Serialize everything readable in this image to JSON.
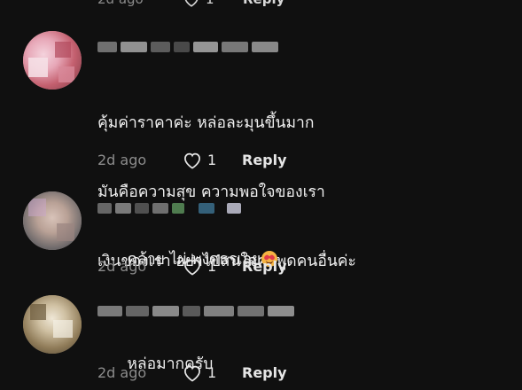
{
  "top_row": {
    "ago": "2d ago",
    "likes": "1",
    "reply_label": "Reply"
  },
  "comments": [
    {
      "text_lines": [
        "คุ้มค่าราคาค่ะ หล่อละมุนขึ้นมาก",
        "มันคือความสุข ความพอใจของเรา",
        "เงินของเรา อย่าไปสนใจคำพูดคนอื่นค่ะ"
      ],
      "ago": "2d ago",
      "likes": "1",
      "reply_label": "Reply"
    },
    {
      "text": "คล้าย ไผ่ พงศธรเลย",
      "emoji": "smiling-face-with-hearts",
      "ago": "2d ago",
      "likes": "1",
      "reply_label": "Reply"
    },
    {
      "text": "หล่อมากครับ",
      "ago": "2d ago",
      "likes": "1",
      "reply_label": "Reply"
    }
  ],
  "icons": {
    "like": "heart-outline-icon"
  },
  "colors": {
    "background": "#101010",
    "text": "#f0f0f0",
    "muted": "#8c8c8c"
  }
}
